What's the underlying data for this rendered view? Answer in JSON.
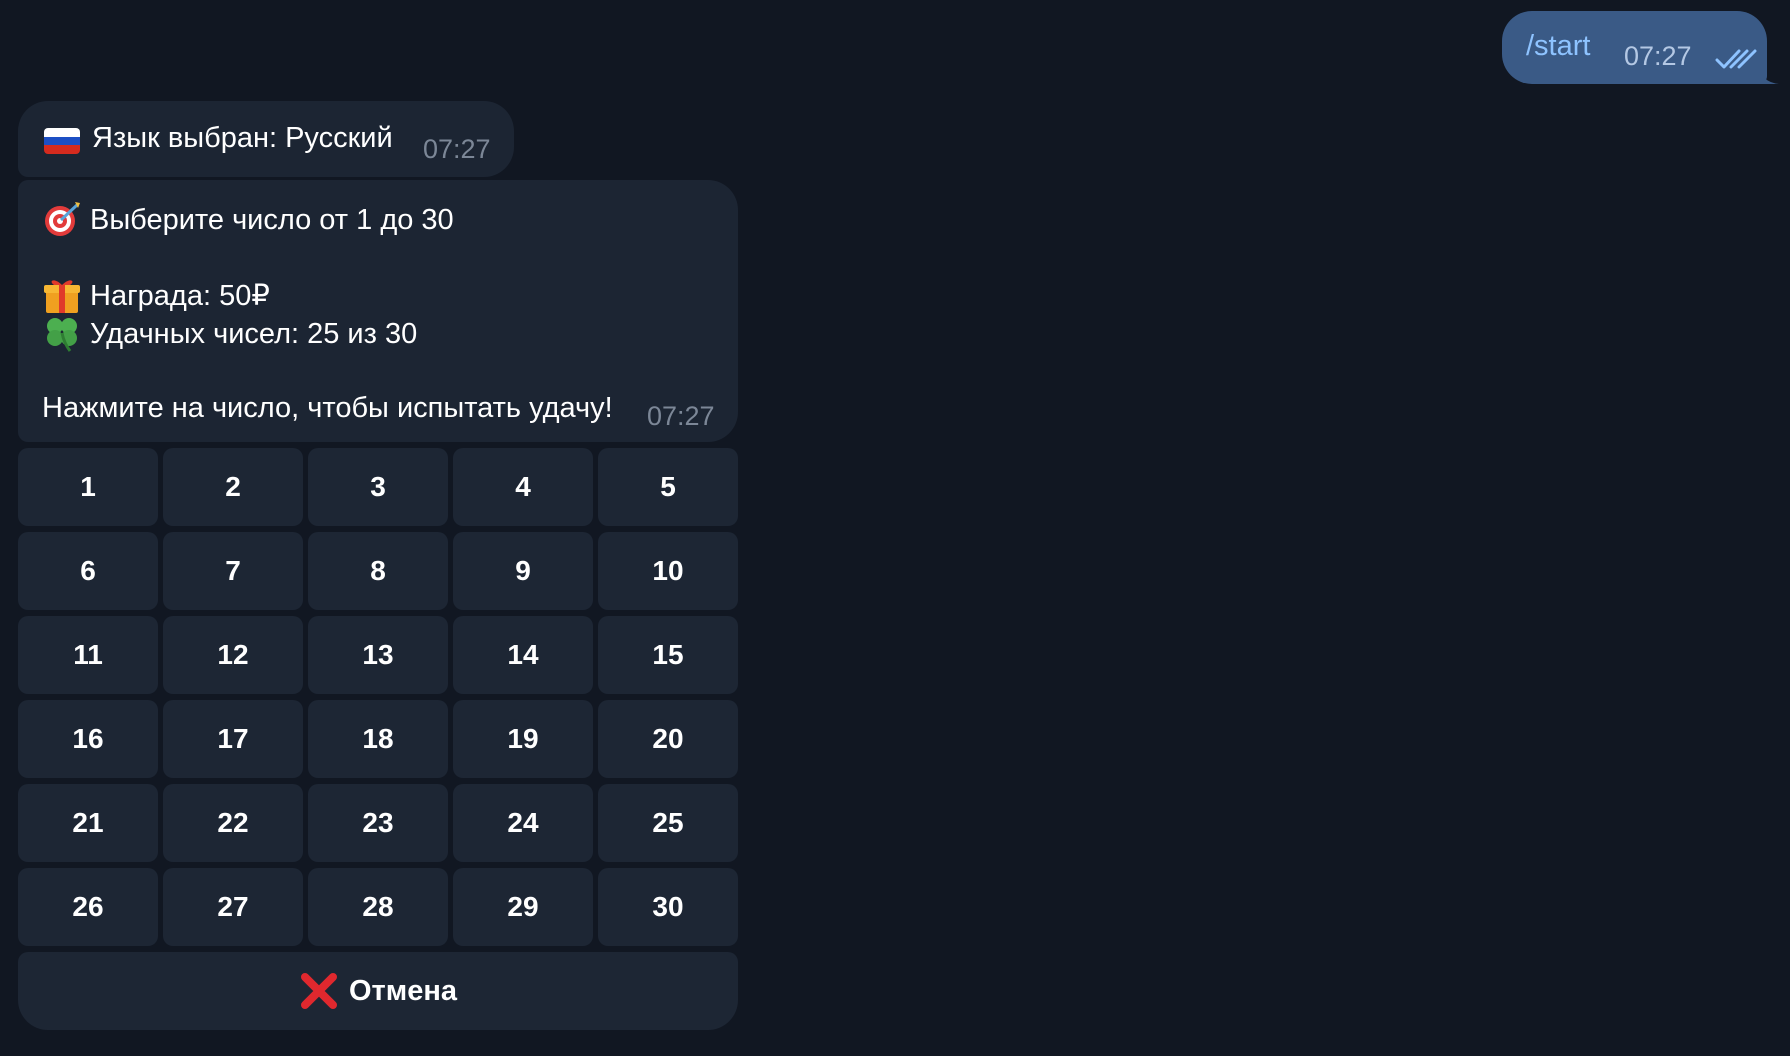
{
  "outgoing": {
    "text": "/start",
    "time": "07:27",
    "status_icon": "double-check-icon"
  },
  "incoming_language": {
    "flag_icon": "russia-flag-icon",
    "text": "Язык выбран: Русский",
    "time": "07:27"
  },
  "incoming_game": {
    "line1_icon": "dart-target-icon",
    "line1": "Выберите число от 1 до 30",
    "line2_icon": "gift-icon",
    "line2": "Награда: 50₽",
    "line3_icon": "four-leaf-clover-icon",
    "line3": "Удачных чисел: 25 из 30",
    "line4": "Нажмите на число, чтобы испытать удачу!",
    "time": "07:27"
  },
  "keyboard": {
    "numbers": [
      "1",
      "2",
      "3",
      "4",
      "5",
      "6",
      "7",
      "8",
      "9",
      "10",
      "11",
      "12",
      "13",
      "14",
      "15",
      "16",
      "17",
      "18",
      "19",
      "20",
      "21",
      "22",
      "23",
      "24",
      "25",
      "26",
      "27",
      "28",
      "29",
      "30"
    ],
    "cancel_icon": "red-x-icon",
    "cancel_label": "Отмена"
  },
  "colors": {
    "background": "#111722",
    "outgoing_bubble": "#3a5a86",
    "incoming_bubble": "#1c2533",
    "button": "#1d2634",
    "link_text": "#8ec3ff",
    "time_text": "#7c8797"
  }
}
